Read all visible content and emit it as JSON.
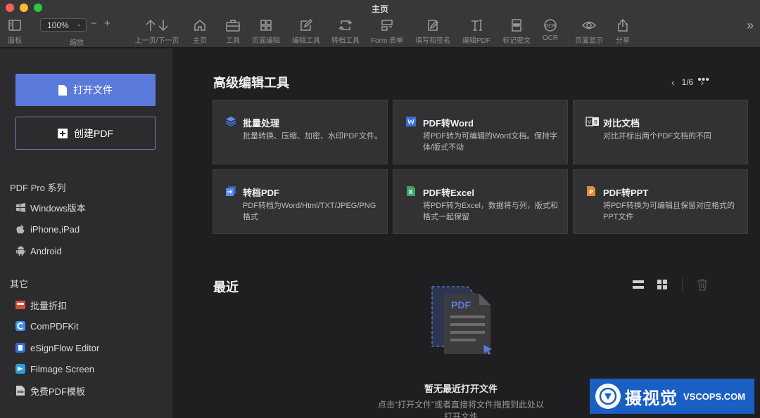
{
  "window": {
    "title": "主页"
  },
  "toolbar": {
    "panel_label": "面板",
    "zoom_value": "100%",
    "zoom_label": "缩放",
    "zoom_minus": "−",
    "zoom_plus": "+",
    "nav_label": "上一页/下一页",
    "home_label": "主页",
    "tools_label": "工具",
    "page_edit_label": "页面编辑",
    "edit_tool_label": "编辑工具",
    "convert_label": "转档工具",
    "form_label": "Form 表单",
    "fill_sign_label": "填写和签名",
    "edit_pdf_label": "编辑PDF",
    "redact_label": "标记密文",
    "ocr_label": "OCR",
    "ocr_icon_text": "OCR",
    "page_display_label": "页面显示",
    "share_label": "分享",
    "overflow_icon_text": "»"
  },
  "sidebar": {
    "open_file": "打开文件",
    "create_pdf": "创建PDF",
    "pro_section": "PDF Pro 系列",
    "pro_items": [
      {
        "label": "Windows版本",
        "icon": "windows-icon"
      },
      {
        "label": "iPhone,iPad",
        "icon": "apple-icon"
      },
      {
        "label": "Android",
        "icon": "android-icon"
      }
    ],
    "other_section": "其它",
    "other_items": [
      {
        "label": "批量折扣",
        "icon": "sale-icon"
      },
      {
        "label": "ComPDFKit",
        "icon": "compdfkit-icon"
      },
      {
        "label": "eSignFlow Editor",
        "icon": "esignflow-icon"
      },
      {
        "label": "Filmage Screen",
        "icon": "filmage-icon"
      },
      {
        "label": "免费PDF模板",
        "icon": "template-icon"
      }
    ]
  },
  "tools": {
    "title": "高级编辑工具",
    "page_indicator": "1/6",
    "more": "•••",
    "cards": [
      {
        "title": "批量处理",
        "desc": "批量转换、压缩、加密、水印PDF文件。",
        "icon": "layers-icon",
        "color": "#4a7bd8"
      },
      {
        "title": "PDF转Word",
        "desc": "将PDF转为可编辑的Word文档。保持字体/版式不动",
        "icon": "word-icon",
        "color": "#3b6fd6"
      },
      {
        "title": "对比文档",
        "desc": "对比并标出两个PDF文档的不同",
        "icon": "compare-icon",
        "color": "#e8e8e8"
      },
      {
        "title": "转档PDF",
        "desc": "PDF转档为Word/Html/TXT/JPEG/PNG格式",
        "icon": "convert-icon",
        "color": "#4a7bd8"
      },
      {
        "title": "PDF转Excel",
        "desc": "将PDF转为Excel，数据将与列，版式和格式一起保留",
        "icon": "excel-icon",
        "color": "#3da463"
      },
      {
        "title": "PDF转PPT",
        "desc": "将PDF转换为可编辑且保留对应格式的PPT文件",
        "icon": "ppt-icon",
        "color": "#e08a3a"
      }
    ]
  },
  "recent": {
    "title": "最近",
    "empty_title": "暂无最近打开文件",
    "empty_desc": "点击“打开文件”或者直接将文件拖拽到此处以打开文件",
    "empty_icon_text": "PDF"
  },
  "watermark": {
    "cn": "摄视觉",
    "en": "VSCOPS.COM"
  }
}
